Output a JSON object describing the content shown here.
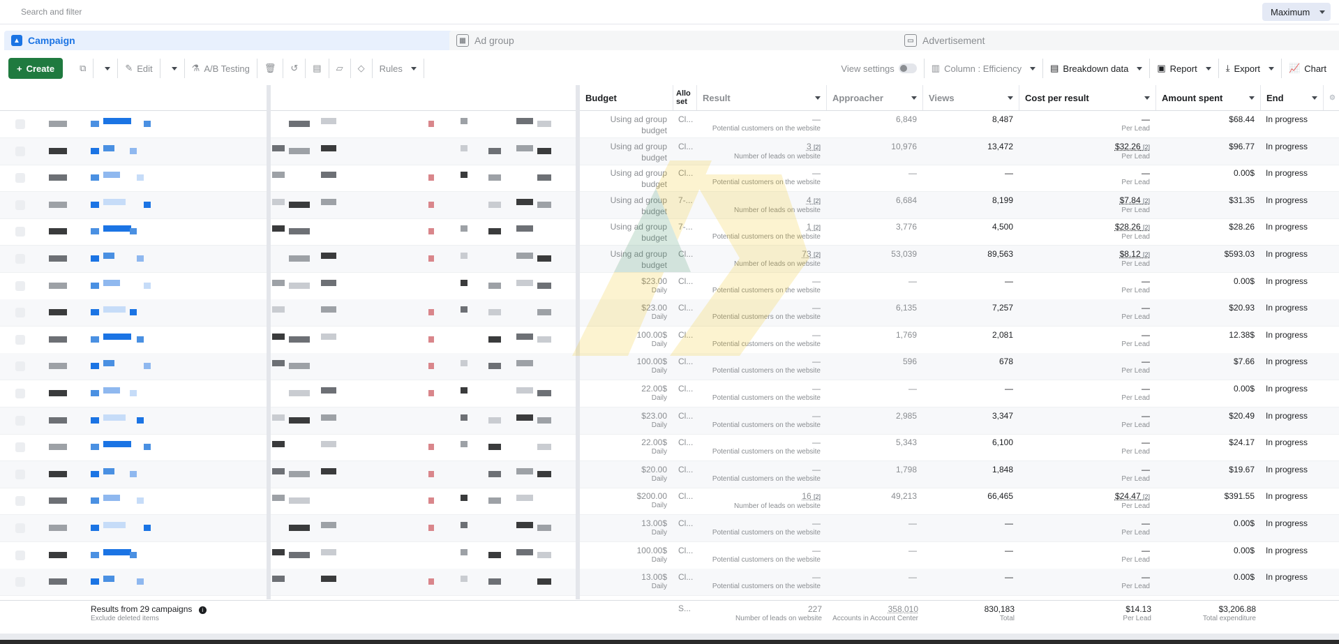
{
  "search": {
    "placeholder": "Search and filter"
  },
  "date_range": {
    "value": "Maximum"
  },
  "tabs": [
    {
      "label": "Campaign",
      "icon": "campaign-icon",
      "active": true
    },
    {
      "label": "Ad group",
      "icon": "ad-group-icon",
      "active": false
    },
    {
      "label": "Advertisement",
      "icon": "advertisement-icon",
      "active": false
    }
  ],
  "toolbar": {
    "create_label": "Create",
    "edit_label": "Edit",
    "ab_label": "A/B Testing",
    "rules_label": "Rules",
    "view_settings_label": "View settings",
    "columns_label": "Column : Efficiency",
    "breakdown_label": "Breakdown data",
    "report_label": "Report",
    "export_label": "Export",
    "chart_label": "Chart"
  },
  "columns": {
    "budget": "Budget",
    "allocation": "Allo set",
    "result": "Result",
    "approacher": "Approacher",
    "views": "Views",
    "cost_per_result": "Cost per result",
    "amount_spent": "Amount spent",
    "end": "End"
  },
  "rows": [
    {
      "budget": "Using ad group budget",
      "budget_sub": "",
      "alloc": "Cl...",
      "result": "—",
      "result_sub": "Potential customers on the website",
      "reach": "6,849",
      "views": "8,487",
      "cpr": "—",
      "cpr_sub": "Per Lead",
      "spent": "$68.44",
      "end": "In progress"
    },
    {
      "budget": "Using ad group budget",
      "budget_sub": "",
      "alloc": "Cl...",
      "result": "3",
      "result_sub": "Number of leads on website",
      "reach": "10,976",
      "views": "13,472",
      "cpr": "$32.26",
      "cpr_sub": "Per Lead",
      "spent": "$96.77",
      "end": "In progress"
    },
    {
      "budget": "Using ad group budget",
      "budget_sub": "",
      "alloc": "Cl...",
      "result": "—",
      "result_sub": "Potential customers on the website",
      "reach": "—",
      "views": "—",
      "cpr": "—",
      "cpr_sub": "Per Lead",
      "spent": "0.00$",
      "end": "In progress"
    },
    {
      "budget": "Using ad group budget",
      "budget_sub": "",
      "alloc": "7-...",
      "result": "4",
      "result_sub": "Number of leads on website",
      "reach": "6,684",
      "views": "8,199",
      "cpr": "$7.84",
      "cpr_sub": "Per Lead",
      "spent": "$31.35",
      "end": "In progress"
    },
    {
      "budget": "Using ad group budget",
      "budget_sub": "",
      "alloc": "7-...",
      "result": "1",
      "result_sub": "Potential customers on the website",
      "reach": "3,776",
      "views": "4,500",
      "cpr": "$28.26",
      "cpr_sub": "Per Lead",
      "spent": "$28.26",
      "end": "In progress"
    },
    {
      "budget": "Using ad group budget",
      "budget_sub": "",
      "alloc": "Cl...",
      "result": "73",
      "result_sub": "Number of leads on website",
      "reach": "53,039",
      "views": "89,563",
      "cpr": "$8.12",
      "cpr_sub": "Per Lead",
      "spent": "$593.03",
      "end": "In progress"
    },
    {
      "budget": "$23.00",
      "budget_sub": "Daily",
      "alloc": "Cl...",
      "result": "—",
      "result_sub": "Potential customers on the website",
      "reach": "—",
      "views": "—",
      "cpr": "—",
      "cpr_sub": "Per Lead",
      "spent": "0.00$",
      "end": "In progress"
    },
    {
      "budget": "$23.00",
      "budget_sub": "Daily",
      "alloc": "Cl...",
      "result": "—",
      "result_sub": "Potential customers on the website",
      "reach": "6,135",
      "views": "7,257",
      "cpr": "—",
      "cpr_sub": "Per Lead",
      "spent": "$20.93",
      "end": "In progress"
    },
    {
      "budget": "100.00$",
      "budget_sub": "Daily",
      "alloc": "Cl...",
      "result": "—",
      "result_sub": "Potential customers on the website",
      "reach": "1,769",
      "views": "2,081",
      "cpr": "—",
      "cpr_sub": "Per Lead",
      "spent": "12.38$",
      "end": "In progress"
    },
    {
      "budget": "100.00$",
      "budget_sub": "Daily",
      "alloc": "Cl...",
      "result": "—",
      "result_sub": "Potential customers on the website",
      "reach": "596",
      "views": "678",
      "cpr": "—",
      "cpr_sub": "Per Lead",
      "spent": "$7.66",
      "end": "In progress"
    },
    {
      "budget": "22.00$",
      "budget_sub": "Daily",
      "alloc": "Cl...",
      "result": "—",
      "result_sub": "Potential customers on the website",
      "reach": "—",
      "views": "—",
      "cpr": "—",
      "cpr_sub": "Per Lead",
      "spent": "0.00$",
      "end": "In progress"
    },
    {
      "budget": "$23.00",
      "budget_sub": "Daily",
      "alloc": "Cl...",
      "result": "—",
      "result_sub": "Potential customers on the website",
      "reach": "2,985",
      "views": "3,347",
      "cpr": "—",
      "cpr_sub": "Per Lead",
      "spent": "$20.49",
      "end": "In progress"
    },
    {
      "budget": "22.00$",
      "budget_sub": "Daily",
      "alloc": "Cl...",
      "result": "—",
      "result_sub": "Potential customers on the website",
      "reach": "5,343",
      "views": "6,100",
      "cpr": "—",
      "cpr_sub": "Per Lead",
      "spent": "$24.17",
      "end": "In progress"
    },
    {
      "budget": "$20.00",
      "budget_sub": "Daily",
      "alloc": "Cl...",
      "result": "—",
      "result_sub": "Potential customers on the website",
      "reach": "1,798",
      "views": "1,848",
      "cpr": "—",
      "cpr_sub": "Per Lead",
      "spent": "$19.67",
      "end": "In progress"
    },
    {
      "budget": "$200.00",
      "budget_sub": "Daily",
      "alloc": "Cl...",
      "result": "16",
      "result_sub": "Number of leads on website",
      "reach": "49,213",
      "views": "66,465",
      "cpr": "$24.47",
      "cpr_sub": "Per Lead",
      "spent": "$391.55",
      "end": "In progress"
    },
    {
      "budget": "13.00$",
      "budget_sub": "Daily",
      "alloc": "Cl...",
      "result": "—",
      "result_sub": "Potential customers on the website",
      "reach": "—",
      "views": "—",
      "cpr": "—",
      "cpr_sub": "Per Lead",
      "spent": "0.00$",
      "end": "In progress"
    },
    {
      "budget": "100.00$",
      "budget_sub": "Daily",
      "alloc": "Cl...",
      "result": "—",
      "result_sub": "Potential customers on the website",
      "reach": "—",
      "views": "—",
      "cpr": "—",
      "cpr_sub": "Per Lead",
      "spent": "0.00$",
      "end": "In progress"
    },
    {
      "budget": "13.00$",
      "budget_sub": "Daily",
      "alloc": "Cl...",
      "result": "—",
      "result_sub": "Potential customers on the website",
      "reach": "—",
      "views": "—",
      "cpr": "—",
      "cpr_sub": "Per Lead",
      "spent": "0.00$",
      "end": "In progress"
    }
  ],
  "footer": {
    "summary": "Results from 29 campaigns",
    "summary_sub": "Exclude deleted items",
    "alloc": "S...",
    "result": "227",
    "result_sub": "Number of leads on website",
    "reach": "358,010",
    "reach_sub": "Accounts in Account Center",
    "views": "830,183",
    "views_sub": "Total",
    "cpr": "$14.13",
    "cpr_sub": "Per Lead",
    "spent": "$3,206.88",
    "spent_sub": "Total expenditure"
  },
  "colors": {
    "accent": "#1b74e4",
    "create": "#1f7a3f"
  }
}
